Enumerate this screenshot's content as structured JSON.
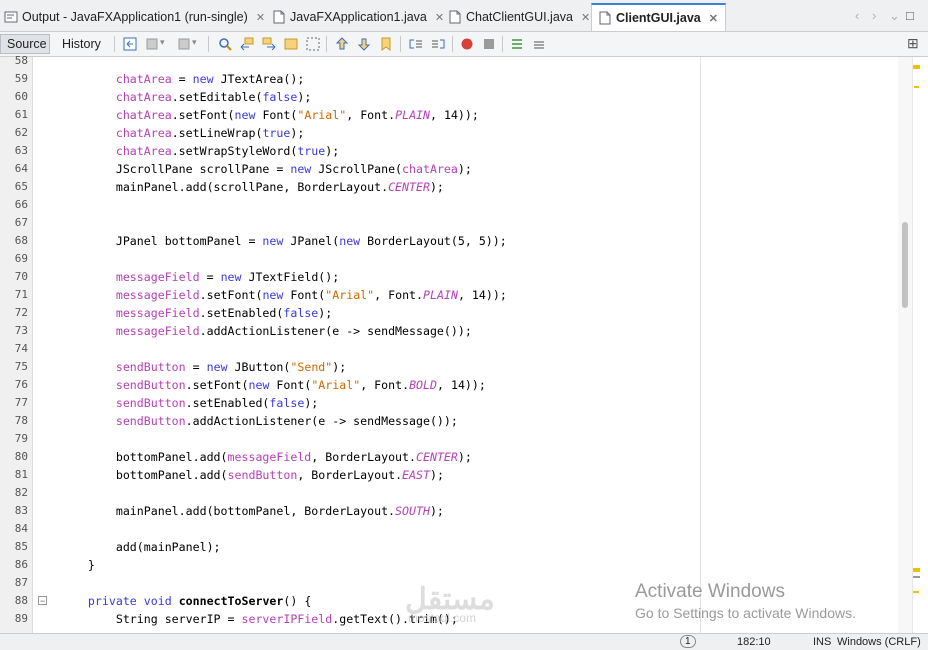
{
  "tabs": [
    {
      "label": "Output - JavaFXApplication1 (run-single)",
      "icon": "output-icon",
      "active": false
    },
    {
      "label": "JavaFXApplication1.java",
      "icon": "java-file-icon",
      "active": false
    },
    {
      "label": "ChatClientGUI.java",
      "icon": "java-file-icon",
      "active": false
    },
    {
      "label": "ClientGUI.java",
      "icon": "java-file-icon",
      "active": true
    }
  ],
  "toolbar": {
    "source_label": "Source",
    "history_label": "History"
  },
  "lines": [
    {
      "n": "58",
      "html": ""
    },
    {
      "n": "59",
      "html": "        <span class=\"fld\">chatArea</span> = <span class=\"kw\">new</span> JTextArea();"
    },
    {
      "n": "60",
      "html": "        <span class=\"fld\">chatArea</span>.setEditable(<span class=\"kw\">false</span>);"
    },
    {
      "n": "61",
      "html": "        <span class=\"fld\">chatArea</span>.setFont(<span class=\"kw\">new</span> Font(<span class=\"str\">\"Arial\"</span>, Font.<span class=\"cst\">PLAIN</span>, 14));"
    },
    {
      "n": "62",
      "html": "        <span class=\"fld\">chatArea</span>.setLineWrap(<span class=\"kw\">true</span>);"
    },
    {
      "n": "63",
      "html": "        <span class=\"fld\">chatArea</span>.setWrapStyleWord(<span class=\"kw\">true</span>);"
    },
    {
      "n": "64",
      "html": "        JScrollPane scrollPane = <span class=\"kw\">new</span> JScrollPane(<span class=\"fld\">chatArea</span>);"
    },
    {
      "n": "65",
      "html": "        mainPanel.add(scrollPane, BorderLayout.<span class=\"cst\">CENTER</span>);"
    },
    {
      "n": "66",
      "html": ""
    },
    {
      "n": "67",
      "html": ""
    },
    {
      "n": "68",
      "html": "        JPanel bottomPanel = <span class=\"kw\">new</span> JPanel(<span class=\"kw\">new</span> BorderLayout(5, 5));"
    },
    {
      "n": "69",
      "html": ""
    },
    {
      "n": "70",
      "html": "        <span class=\"fld\">messageField</span> = <span class=\"kw\">new</span> JTextField();"
    },
    {
      "n": "71",
      "html": "        <span class=\"fld\">messageField</span>.setFont(<span class=\"kw\">new</span> Font(<span class=\"str\">\"Arial\"</span>, Font.<span class=\"cst\">PLAIN</span>, 14));"
    },
    {
      "n": "72",
      "html": "        <span class=\"fld\">messageField</span>.setEnabled(<span class=\"kw\">false</span>);"
    },
    {
      "n": "73",
      "html": "        <span class=\"fld\">messageField</span>.addActionListener(e -&gt; sendMessage());"
    },
    {
      "n": "74",
      "html": ""
    },
    {
      "n": "75",
      "html": "        <span class=\"fld\">sendButton</span> = <span class=\"kw\">new</span> JButton(<span class=\"str\">\"Send\"</span>);"
    },
    {
      "n": "76",
      "html": "        <span class=\"fld\">sendButton</span>.setFont(<span class=\"kw\">new</span> Font(<span class=\"str\">\"Arial\"</span>, Font.<span class=\"cst\">BOLD</span>, 14));"
    },
    {
      "n": "77",
      "html": "        <span class=\"fld\">sendButton</span>.setEnabled(<span class=\"kw\">false</span>);"
    },
    {
      "n": "78",
      "html": "        <span class=\"fld\">sendButton</span>.addActionListener(e -&gt; sendMessage());"
    },
    {
      "n": "79",
      "html": ""
    },
    {
      "n": "80",
      "html": "        bottomPanel.add(<span class=\"fld\">messageField</span>, BorderLayout.<span class=\"cst\">CENTER</span>);"
    },
    {
      "n": "81",
      "html": "        bottomPanel.add(<span class=\"fld\">sendButton</span>, BorderLayout.<span class=\"cst\">EAST</span>);"
    },
    {
      "n": "82",
      "html": ""
    },
    {
      "n": "83",
      "html": "        mainPanel.add(bottomPanel, BorderLayout.<span class=\"cst\">SOUTH</span>);"
    },
    {
      "n": "84",
      "html": ""
    },
    {
      "n": "85",
      "html": "        add(mainPanel);"
    },
    {
      "n": "86",
      "html": "    }"
    },
    {
      "n": "87",
      "html": ""
    },
    {
      "n": "88",
      "html": "    <span class=\"kw\">private</span> <span class=\"kw\">void</span> <b>connectToServer</b>() {"
    },
    {
      "n": "89",
      "html": "        String serverIP = <span class=\"fld\">serverIPField</span>.getText().trim();"
    }
  ],
  "status": {
    "notifications": "1",
    "position": "182:10",
    "insert_mode": "INS",
    "line_endings": "Windows (CRLF)"
  },
  "watermark": {
    "title": "Activate Windows",
    "subtitle": "Go to Settings to activate Windows."
  },
  "logo": {
    "text": "مستقل",
    "sub": "mostaql.com"
  }
}
